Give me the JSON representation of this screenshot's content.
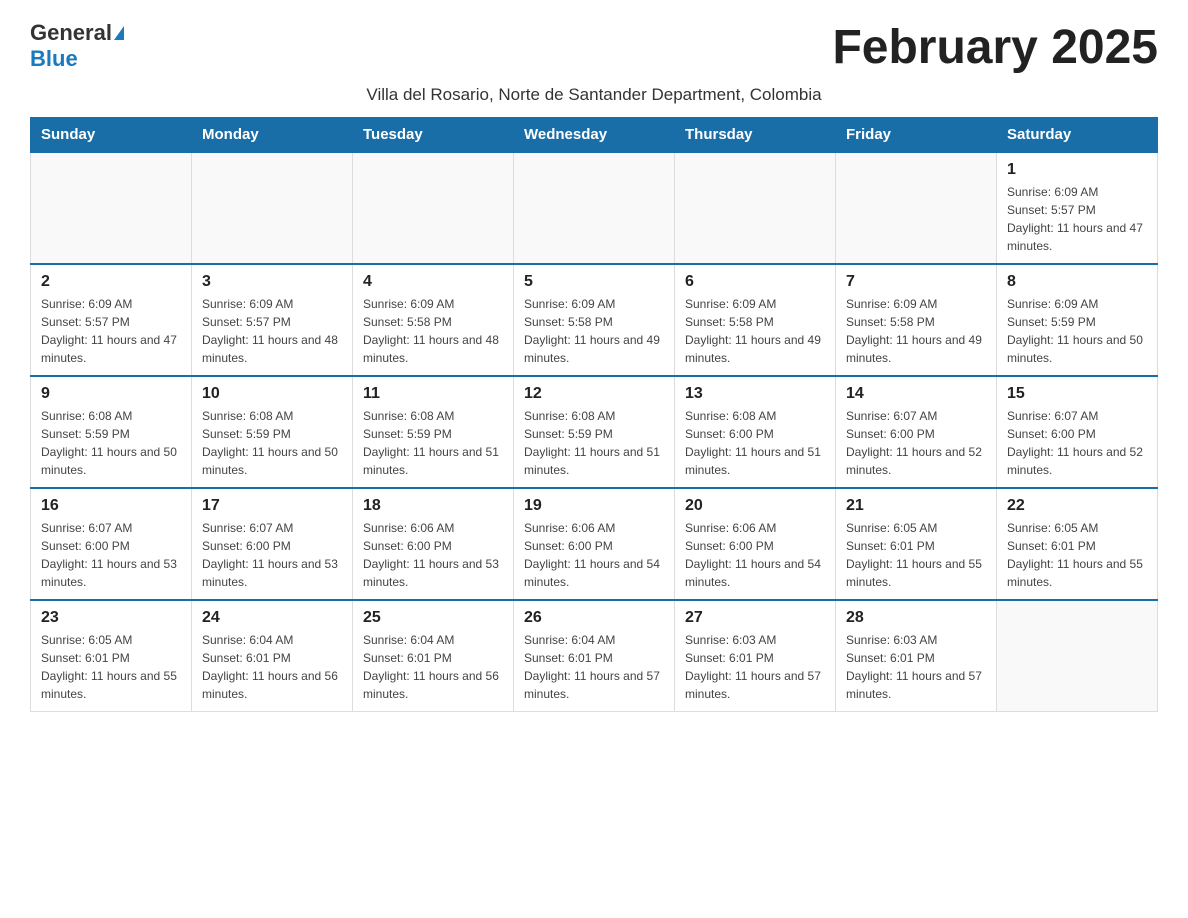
{
  "header": {
    "logo_general": "General",
    "logo_blue": "Blue",
    "title": "February 2025",
    "subtitle": "Villa del Rosario, Norte de Santander Department, Colombia"
  },
  "days_of_week": [
    "Sunday",
    "Monday",
    "Tuesday",
    "Wednesday",
    "Thursday",
    "Friday",
    "Saturday"
  ],
  "weeks": [
    [
      {
        "day": "",
        "info": ""
      },
      {
        "day": "",
        "info": ""
      },
      {
        "day": "",
        "info": ""
      },
      {
        "day": "",
        "info": ""
      },
      {
        "day": "",
        "info": ""
      },
      {
        "day": "",
        "info": ""
      },
      {
        "day": "1",
        "info": "Sunrise: 6:09 AM\nSunset: 5:57 PM\nDaylight: 11 hours and 47 minutes."
      }
    ],
    [
      {
        "day": "2",
        "info": "Sunrise: 6:09 AM\nSunset: 5:57 PM\nDaylight: 11 hours and 47 minutes."
      },
      {
        "day": "3",
        "info": "Sunrise: 6:09 AM\nSunset: 5:57 PM\nDaylight: 11 hours and 48 minutes."
      },
      {
        "day": "4",
        "info": "Sunrise: 6:09 AM\nSunset: 5:58 PM\nDaylight: 11 hours and 48 minutes."
      },
      {
        "day": "5",
        "info": "Sunrise: 6:09 AM\nSunset: 5:58 PM\nDaylight: 11 hours and 49 minutes."
      },
      {
        "day": "6",
        "info": "Sunrise: 6:09 AM\nSunset: 5:58 PM\nDaylight: 11 hours and 49 minutes."
      },
      {
        "day": "7",
        "info": "Sunrise: 6:09 AM\nSunset: 5:58 PM\nDaylight: 11 hours and 49 minutes."
      },
      {
        "day": "8",
        "info": "Sunrise: 6:09 AM\nSunset: 5:59 PM\nDaylight: 11 hours and 50 minutes."
      }
    ],
    [
      {
        "day": "9",
        "info": "Sunrise: 6:08 AM\nSunset: 5:59 PM\nDaylight: 11 hours and 50 minutes."
      },
      {
        "day": "10",
        "info": "Sunrise: 6:08 AM\nSunset: 5:59 PM\nDaylight: 11 hours and 50 minutes."
      },
      {
        "day": "11",
        "info": "Sunrise: 6:08 AM\nSunset: 5:59 PM\nDaylight: 11 hours and 51 minutes."
      },
      {
        "day": "12",
        "info": "Sunrise: 6:08 AM\nSunset: 5:59 PM\nDaylight: 11 hours and 51 minutes."
      },
      {
        "day": "13",
        "info": "Sunrise: 6:08 AM\nSunset: 6:00 PM\nDaylight: 11 hours and 51 minutes."
      },
      {
        "day": "14",
        "info": "Sunrise: 6:07 AM\nSunset: 6:00 PM\nDaylight: 11 hours and 52 minutes."
      },
      {
        "day": "15",
        "info": "Sunrise: 6:07 AM\nSunset: 6:00 PM\nDaylight: 11 hours and 52 minutes."
      }
    ],
    [
      {
        "day": "16",
        "info": "Sunrise: 6:07 AM\nSunset: 6:00 PM\nDaylight: 11 hours and 53 minutes."
      },
      {
        "day": "17",
        "info": "Sunrise: 6:07 AM\nSunset: 6:00 PM\nDaylight: 11 hours and 53 minutes."
      },
      {
        "day": "18",
        "info": "Sunrise: 6:06 AM\nSunset: 6:00 PM\nDaylight: 11 hours and 53 minutes."
      },
      {
        "day": "19",
        "info": "Sunrise: 6:06 AM\nSunset: 6:00 PM\nDaylight: 11 hours and 54 minutes."
      },
      {
        "day": "20",
        "info": "Sunrise: 6:06 AM\nSunset: 6:00 PM\nDaylight: 11 hours and 54 minutes."
      },
      {
        "day": "21",
        "info": "Sunrise: 6:05 AM\nSunset: 6:01 PM\nDaylight: 11 hours and 55 minutes."
      },
      {
        "day": "22",
        "info": "Sunrise: 6:05 AM\nSunset: 6:01 PM\nDaylight: 11 hours and 55 minutes."
      }
    ],
    [
      {
        "day": "23",
        "info": "Sunrise: 6:05 AM\nSunset: 6:01 PM\nDaylight: 11 hours and 55 minutes."
      },
      {
        "day": "24",
        "info": "Sunrise: 6:04 AM\nSunset: 6:01 PM\nDaylight: 11 hours and 56 minutes."
      },
      {
        "day": "25",
        "info": "Sunrise: 6:04 AM\nSunset: 6:01 PM\nDaylight: 11 hours and 56 minutes."
      },
      {
        "day": "26",
        "info": "Sunrise: 6:04 AM\nSunset: 6:01 PM\nDaylight: 11 hours and 57 minutes."
      },
      {
        "day": "27",
        "info": "Sunrise: 6:03 AM\nSunset: 6:01 PM\nDaylight: 11 hours and 57 minutes."
      },
      {
        "day": "28",
        "info": "Sunrise: 6:03 AM\nSunset: 6:01 PM\nDaylight: 11 hours and 57 minutes."
      },
      {
        "day": "",
        "info": ""
      }
    ]
  ]
}
